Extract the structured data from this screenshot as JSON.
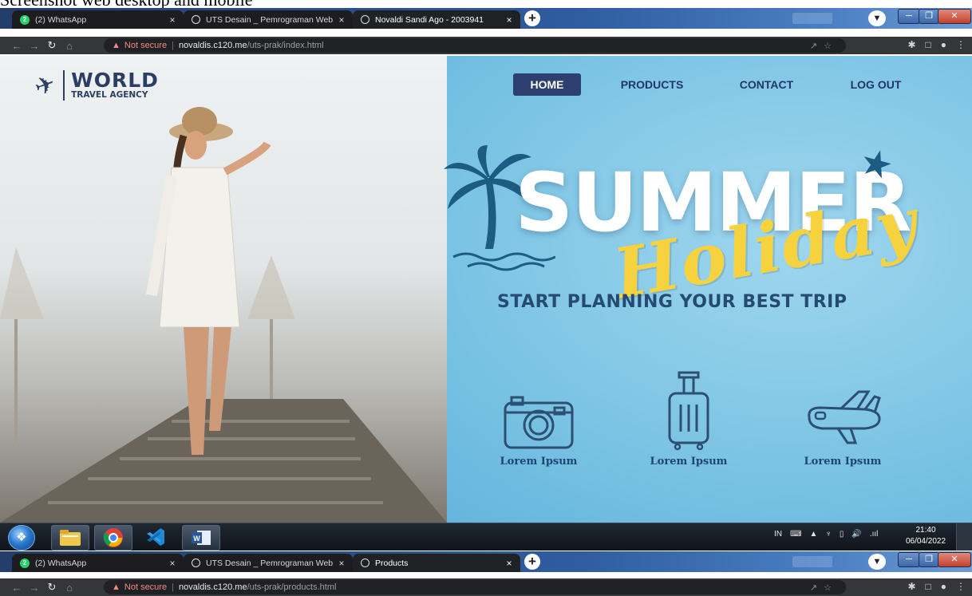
{
  "doc_title": "Screenshot web desktop and mobile",
  "window1": {
    "tabs": [
      {
        "label": "(2) WhatsApp",
        "icon": "whatsapp-icon",
        "close": "×"
      },
      {
        "label": "UTS Desain _ Pemrograman Web",
        "icon": "globe-icon",
        "close": "×"
      },
      {
        "label": "Novaldi Sandi Ago - 2003941",
        "icon": "globe-icon",
        "close": "×"
      }
    ],
    "new_tab": "+",
    "address": {
      "warning": "Not secure",
      "host": "novaldis.c120.me",
      "path": "/uts-prak/index.html"
    }
  },
  "page": {
    "logo_main": "WORLD",
    "logo_sub": "TRAVEL AGENCY",
    "nav": [
      "HOME",
      "PRODUCTS",
      "CONTACT",
      "LOG OUT"
    ],
    "headline": "SUMMER",
    "headline_script": "Holiday",
    "tagline": "START PLANNING YOUR BEST TRIP",
    "features": [
      {
        "label": "Lorem Ipsum",
        "icon": "camera-icon"
      },
      {
        "label": "Lorem Ipsum",
        "icon": "suitcase-icon"
      },
      {
        "label": "Lorem Ipsum",
        "icon": "airplane-icon"
      }
    ],
    "colors": {
      "nav_active": "#2c3f6e",
      "accent_yellow": "#f6d33e",
      "navy": "#1f3768"
    }
  },
  "taskbar": {
    "apps": [
      "start-orb",
      "file-explorer-icon",
      "chrome-icon",
      "vscode-icon",
      "word-icon"
    ],
    "tray_lang": "IN",
    "tray_signal": ".ııl",
    "time": "21:40",
    "date": "06/04/2022"
  },
  "window2": {
    "tabs": [
      {
        "label": "(2) WhatsApp",
        "icon": "whatsapp-icon",
        "close": "×"
      },
      {
        "label": "UTS Desain _ Pemrograman Web",
        "icon": "globe-icon",
        "close": "×"
      },
      {
        "label": "Products",
        "icon": "globe-icon",
        "close": "×"
      }
    ],
    "new_tab": "+",
    "address": {
      "warning": "Not secure",
      "host": "novaldis.c120.me",
      "path": "/uts-prak/products.html"
    }
  }
}
